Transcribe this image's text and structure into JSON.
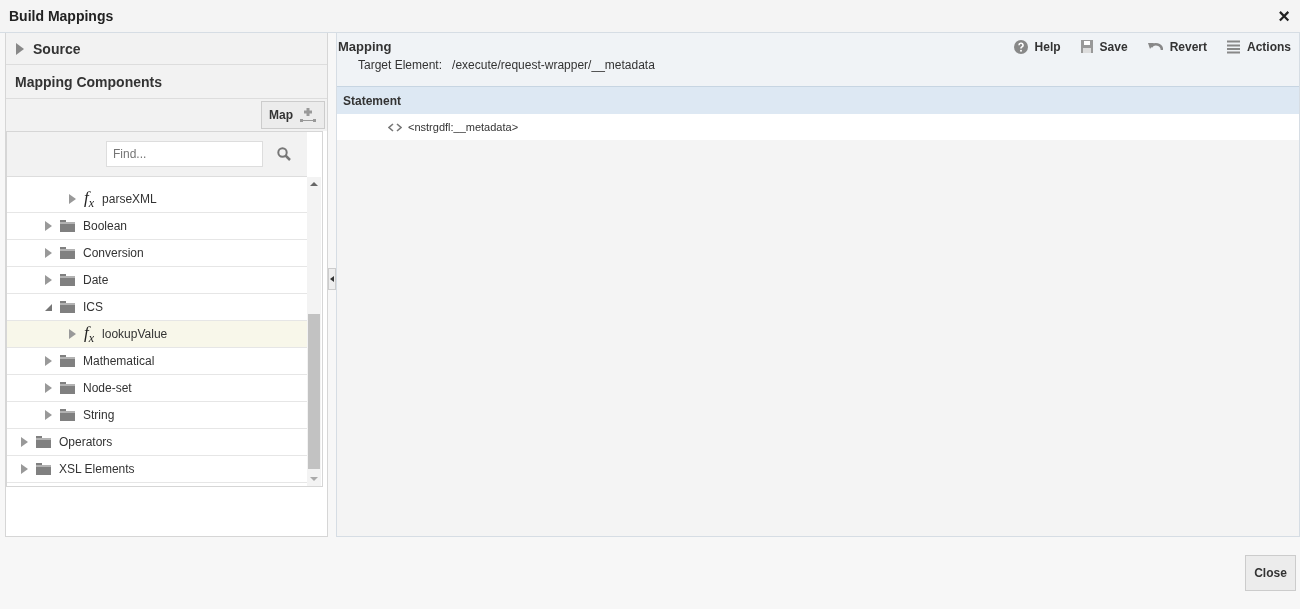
{
  "window": {
    "title": "Build Mappings",
    "close": "×"
  },
  "source": {
    "label": "Source",
    "expanded": false
  },
  "components": {
    "title": "Mapping Components",
    "map_button": "Map",
    "search": {
      "placeholder": "Find..."
    },
    "tree": [
      {
        "children": [
          {
            "children": [
              {
                "label": "parseXML",
                "kind": "function",
                "icon": "f$_{x}$",
                "expanded": false,
                "selected": false
              }
            ]
          },
          {
            "label": "Boolean",
            "kind": "folder",
            "expanded": false,
            "selected": false
          },
          {
            "label": "Conversion",
            "kind": "folder",
            "expanded": false,
            "selected": false
          },
          {
            "label": "Date",
            "kind": "folder",
            "expanded": false,
            "selected": false
          },
          {
            "label": "ICS",
            "kind": "folder",
            "expanded": true,
            "selected": false,
            "children": [
              {
                "label": "lookupValue",
                "kind": "function",
                "icon": "f$_{x}$",
                "expanded": false,
                "selected": true
              }
            ]
          },
          {
            "label": "Mathematical",
            "kind": "folder",
            "expanded": false,
            "selected": false
          },
          {
            "label": "Node-set",
            "kind": "folder",
            "expanded": false,
            "selected": false
          },
          {
            "label": "String",
            "kind": "folder",
            "expanded": false,
            "selected": false
          }
        ]
      },
      {
        "label": "Operators",
        "kind": "folder",
        "expanded": false,
        "selected": false
      },
      {
        "label": "XSL Elements",
        "kind": "folder",
        "expanded": false,
        "selected": false
      }
    ]
  },
  "mapping": {
    "title": "Mapping",
    "target_label": "Target Element:",
    "target_value": "/execute/request-wrapper/__metadata",
    "toolbar": [
      {
        "label": "Help",
        "kind": "help"
      },
      {
        "label": "Save",
        "kind": "save"
      },
      {
        "label": "Revert",
        "kind": "revert"
      },
      {
        "label": "Actions",
        "kind": "actions"
      }
    ],
    "statement_header": "Statement",
    "statement": "<nstrgdfl:__metadata>"
  },
  "buttons": [
    "Close"
  ]
}
